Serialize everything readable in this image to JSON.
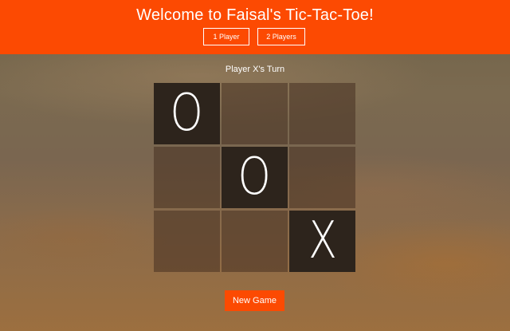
{
  "header": {
    "title": "Welcome to Faisal's Tic-Tac-Toe!",
    "one_player_label": "1 Player",
    "two_players_label": "2 Players"
  },
  "status": {
    "turn_text": "Player X's Turn"
  },
  "board": {
    "cells": [
      "O",
      "",
      "",
      "",
      "O",
      "",
      "",
      "",
      "X"
    ]
  },
  "controls": {
    "new_game_label": "New Game"
  },
  "colors": {
    "accent": "#fc4a02",
    "filled_cell": "#2d241c",
    "text": "#ffffff"
  }
}
